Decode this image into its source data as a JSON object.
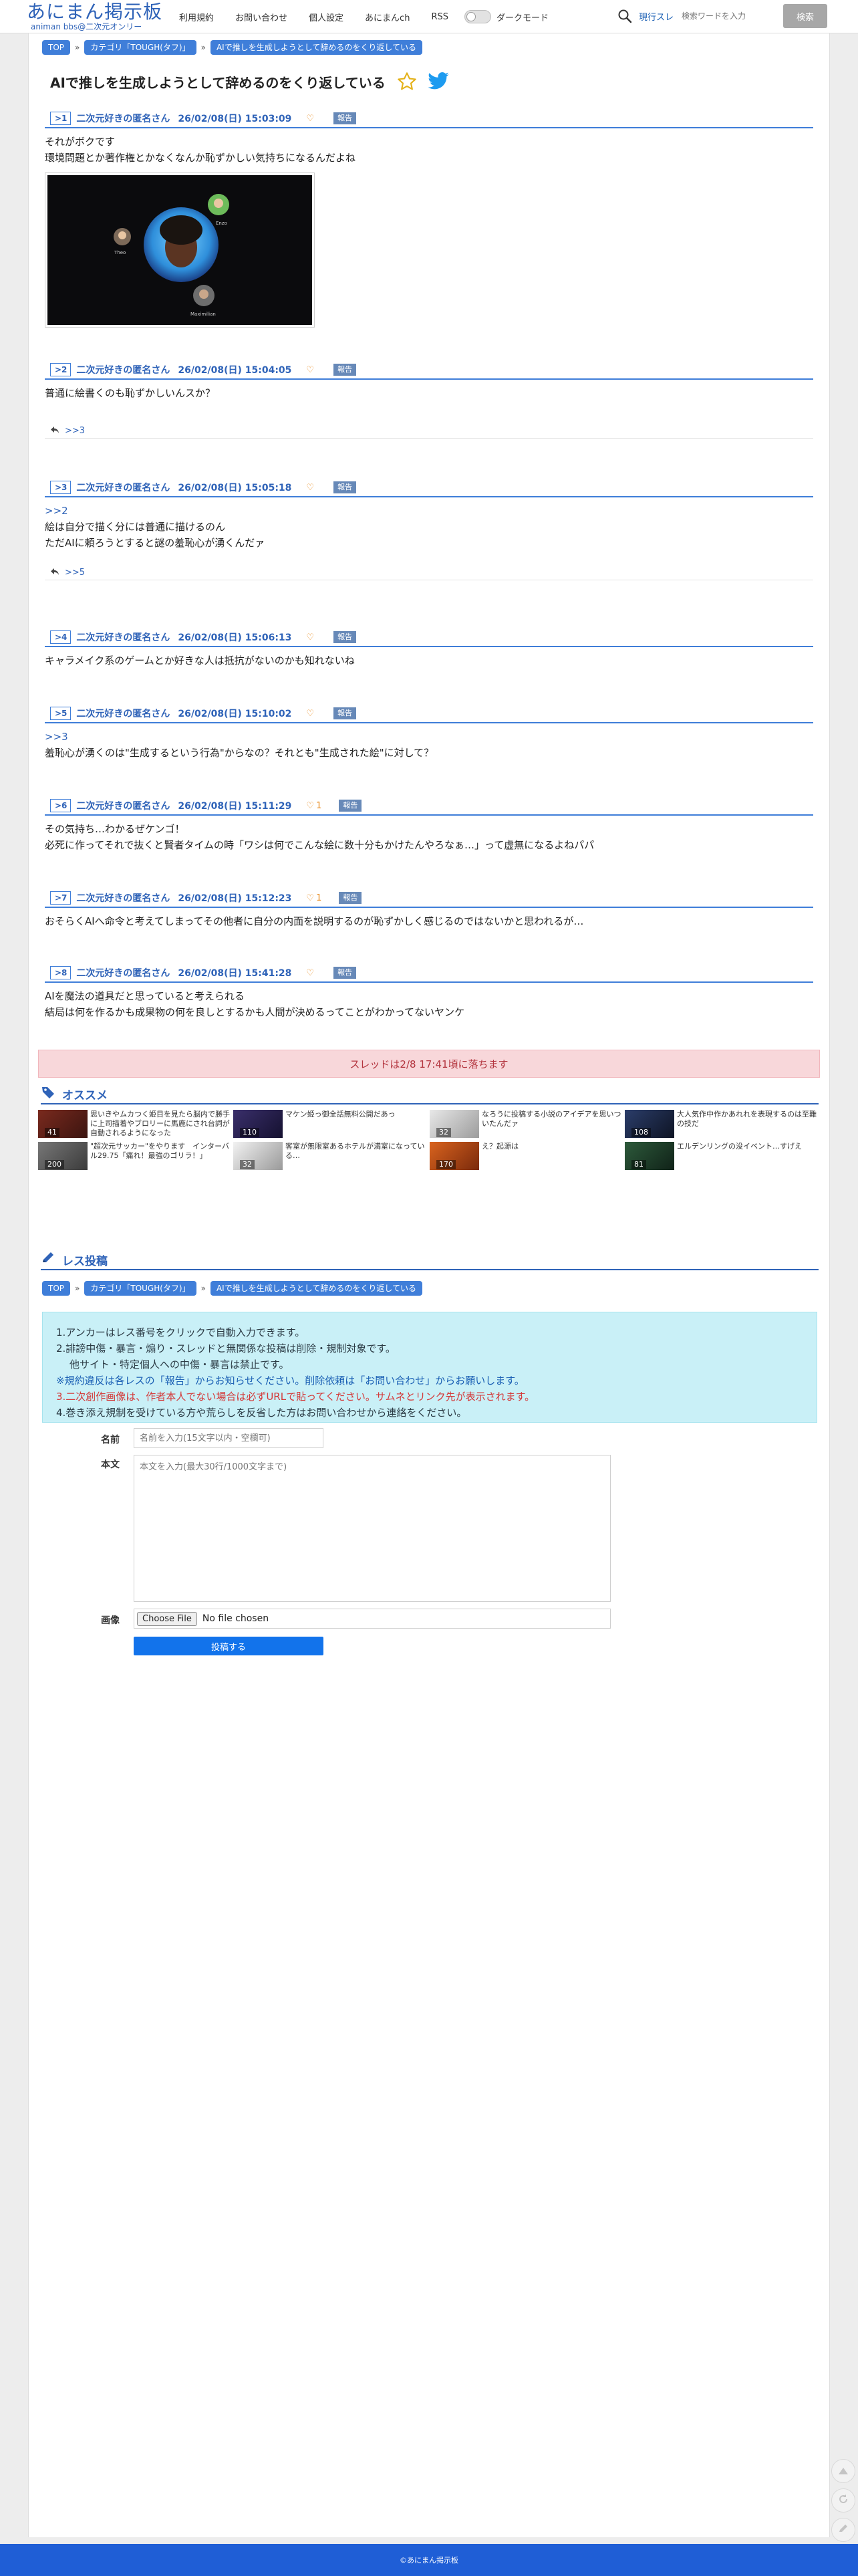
{
  "header": {
    "logo_main": "あにまん掲示板",
    "logo_sub": "animan bbs@二次元オンリー",
    "nav": [
      "利用規約",
      "お問い合わせ",
      "個人設定",
      "あにまんch",
      "RSS"
    ],
    "dark_mode_label": "ダークモード",
    "search_mode": "現行スレ",
    "search_placeholder": "検索ワードを入力",
    "search_button": "検索"
  },
  "breadcrumb": {
    "top": "TOP",
    "category": "カテゴリ「TOUGH(タフ)」",
    "current": "AIで推しを生成しようとして辞めるのをくり返している"
  },
  "thread": {
    "title": "AIで推しを生成しようとして辞めるのをくり返している"
  },
  "report_label": "報告",
  "posts": [
    {
      "num": ">1",
      "name": "二次元好きの匿名さん",
      "date": "26/02/08(日) 15:03:09",
      "likes": "",
      "lines": [
        "それがボクです",
        "環境問題とか著作権とかなくなんか恥ずかしい気持ちになるんだよね"
      ],
      "reply": ""
    },
    {
      "num": ">2",
      "name": "二次元好きの匿名さん",
      "date": "26/02/08(日) 15:04:05",
      "likes": "",
      "lines": [
        "普通に絵書くのも恥ずかしいんスか？"
      ],
      "reply": ">>3"
    },
    {
      "num": ">3",
      "name": "二次元好きの匿名さん",
      "date": "26/02/08(日) 15:05:18",
      "likes": "",
      "anchor": ">>2",
      "lines": [
        "絵は自分で描く分には普通に描けるのん",
        "ただAIに頼ろうとすると謎の羞恥心が湧くんだァ"
      ],
      "reply": ">>5"
    },
    {
      "num": ">4",
      "name": "二次元好きの匿名さん",
      "date": "26/02/08(日) 15:06:13",
      "likes": "",
      "lines": [
        "キャラメイク系のゲームとか好きな人は抵抗がないのかも知れないね"
      ],
      "reply": ""
    },
    {
      "num": ">5",
      "name": "二次元好きの匿名さん",
      "date": "26/02/08(日) 15:10:02",
      "likes": "",
      "anchor": ">>3",
      "lines": [
        "羞恥心が湧くのは\"生成するという行為\"からなの？それとも\"生成された絵\"に対して？"
      ],
      "reply": ""
    },
    {
      "num": ">6",
      "name": "二次元好きの匿名さん",
      "date": "26/02/08(日) 15:11:29",
      "likes": "1",
      "lines": [
        "その気持ち…わかるぜケンゴ！",
        "必死に作ってそれで抜くと賢者タイムの時「ワシは何でこんな絵に数十分もかけたんやろなぁ…」って虚無になるよねパパ"
      ],
      "reply": ""
    },
    {
      "num": ">7",
      "name": "二次元好きの匿名さん",
      "date": "26/02/08(日) 15:12:23",
      "likes": "1",
      "lines": [
        "おそらくAIへ命令と考えてしまってその他者に自分の内面を説明するのが恥ずかしく感じるのではないかと思われるが…"
      ],
      "reply": ""
    },
    {
      "num": ">8",
      "name": "二次元好きの匿名さん",
      "date": "26/02/08(日) 15:41:28",
      "likes": "",
      "lines": [
        "AIを魔法の道具だと思っていると考えられる",
        "結局は何を作るかも成果物の何を良しとするかも人間が決めるってことがわかってないヤンケ"
      ],
      "reply": ""
    }
  ],
  "post_image": {
    "labels": [
      "Enzo",
      "Theo",
      "Maximilian"
    ]
  },
  "expire_notice": "スレッドは2/8 17:41頃に落ちます",
  "recommend": {
    "title": "オススメ",
    "items": [
      {
        "count": "41",
        "title": "思いきやムカつく姫目を見たら脳内で勝手に上司描着やブロリーに馬鹿にされ台詞が自動されるようになった"
      },
      {
        "count": "110",
        "title": "マケン姫っ御全話無料公開だあっ"
      },
      {
        "count": "32",
        "title": "なろうに投稿する小説のアイデアを思いついたんだァ"
      },
      {
        "count": "108",
        "title": "大人気作中作かあれれを表現するのは至難の技だ"
      },
      {
        "count": "200",
        "title": "\"超次元サッカー\"をやります　インターバル29.75「痛れ！最強のゴリラ！」"
      },
      {
        "count": "32",
        "title": "客室が無限室あるホテルが満室になっている…"
      },
      {
        "count": "170",
        "title": "え？起源は"
      },
      {
        "count": "81",
        "title": "エルデンリングの没イベント…すげえ"
      }
    ]
  },
  "reply_form": {
    "title": "レス投稿",
    "rules": [
      "1.アンカーはレス番号をクリックで自動入力できます。",
      "2.誹謗中傷・暴言・煽り・スレッドと無関係な投稿は削除・規制対象です。",
      "他サイト・特定個人への中傷・暴言は禁止です。",
      "※規約違反は各レスの「報告」からお知らせください。削除依頼は「お問い合わせ」からお願いします。",
      "3.二次創作画像は、作者本人でない場合は必ずURLで貼ってください。サムネとリンク先が表示されます。",
      "4.巻き添え規制を受けている方や荒らしを反省した方はお問い合わせから連絡をください。"
    ],
    "name_label": "名前",
    "name_placeholder": "名前を入力(15文字以内・空欄可)",
    "body_label": "本文",
    "body_placeholder": "本文を入力(最大30行/1000文字まで)",
    "image_label": "画像",
    "file_button": "Choose File",
    "file_status": "No file chosen",
    "submit": "投稿する"
  },
  "footer": "©あにまん掲示板",
  "colors": {
    "brand_blue": "#2f63b8",
    "accent_blue": "#3f7ed9",
    "footer_blue": "#1f5ed6",
    "expire_bg": "#f8d7da",
    "info_bg": "#c9f0f7",
    "heart_orange": "#e8891a"
  }
}
